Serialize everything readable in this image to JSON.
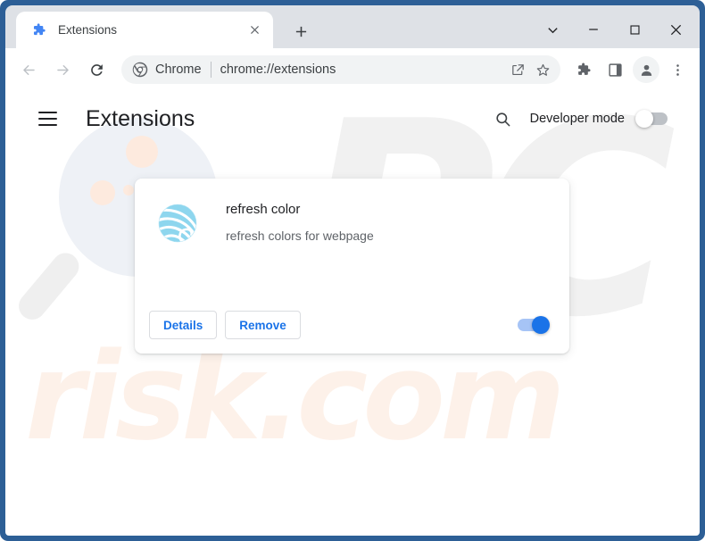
{
  "window": {
    "frame_color": "#2d5f96",
    "controls": [
      {
        "name": "tab-search",
        "glyph": "chevron-down"
      },
      {
        "name": "minimize",
        "glyph": "minus"
      },
      {
        "name": "maximize",
        "glyph": "square"
      },
      {
        "name": "close",
        "glyph": "x"
      }
    ]
  },
  "tabstrip": {
    "tab": {
      "title": "Extensions",
      "favicon": "puzzle-piece-icon",
      "favicon_color": "#4285f4",
      "close_label": "×"
    },
    "new_tab_label": "+"
  },
  "toolbar": {
    "back_label": "←",
    "forward_label": "→",
    "reload_label": "⟳",
    "omnibox": {
      "chrome_logo": "chrome-logo-icon",
      "chip_label": "Chrome",
      "url": "chrome://extensions"
    },
    "actions": [
      {
        "name": "share-icon"
      },
      {
        "name": "bookmark-star-icon"
      }
    ],
    "icons": [
      {
        "name": "extensions-puzzle-icon"
      },
      {
        "name": "side-panel-icon"
      },
      {
        "name": "profile-avatar-icon"
      },
      {
        "name": "chrome-menu-icon"
      }
    ]
  },
  "page": {
    "menu_label": "Main menu",
    "title": "Extensions",
    "search_label": "Search extensions",
    "developer_mode": {
      "label": "Developer mode",
      "enabled": false
    },
    "extension": {
      "name": "refresh color",
      "description": "refresh colors for webpage",
      "icon": "blue-sphere-icon",
      "details_label": "Details",
      "remove_label": "Remove",
      "enabled": true,
      "toggle_on_color": "#1a73e8"
    },
    "watermarks": {
      "primary": "PC",
      "secondary": "risk.com",
      "primary_color": "#f1f1f1",
      "secondary_color": "#fdf1e9"
    }
  }
}
